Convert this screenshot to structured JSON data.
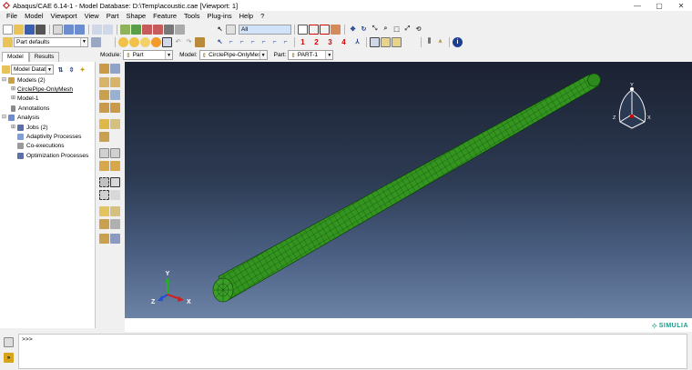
{
  "window": {
    "title": "Abaqus/CAE 6.14-1 - Model Database: D:\\Temp\\acoustic.cae [Viewport: 1]",
    "controls": [
      "—",
      "▢",
      "✕"
    ]
  },
  "menu": [
    "File",
    "Model",
    "Viewport",
    "View",
    "Part",
    "Shape",
    "Feature",
    "Tools",
    "Plug-ins",
    "Help",
    "?"
  ],
  "toolbar": {
    "part_defaults": "Part defaults",
    "selection_filter": "All",
    "view_numbers": [
      "1",
      "2",
      "3",
      "4"
    ]
  },
  "context_bar": {
    "module_label": "Module:",
    "module_value": "Part",
    "model_label": "Model:",
    "model_value": "CirclePipe-OnlyMesh",
    "part_label": "Part:",
    "part_value": "PART-1"
  },
  "left_panel": {
    "tabs": [
      "Model",
      "Results"
    ],
    "filter_value": "Model Datab",
    "tree": {
      "models": "Models (2)",
      "model_a": "CirclePipe-OnlyMesh",
      "model_b": "Model-1",
      "annotations": "Annotations",
      "analysis": "Analysis",
      "jobs": "Jobs (2)",
      "adaptivity": "Adaptivity Processes",
      "coexecutions": "Co-executions",
      "optimization": "Optimization Processes"
    }
  },
  "viewport": {
    "triad": {
      "x": "X",
      "y": "Y",
      "z": "Z"
    },
    "view_cube": {
      "y": "Y",
      "z": "Z",
      "x": "X"
    },
    "mesh_color": "#2f8f1e",
    "mesh_line_color": "#0b3a07"
  },
  "brand": "SIMULIA",
  "message": {
    "prompt": ">>>"
  },
  "colors": {
    "accent_red": "#d40000",
    "viewport_top": "#1b2131",
    "viewport_bottom": "#6d83a6"
  }
}
